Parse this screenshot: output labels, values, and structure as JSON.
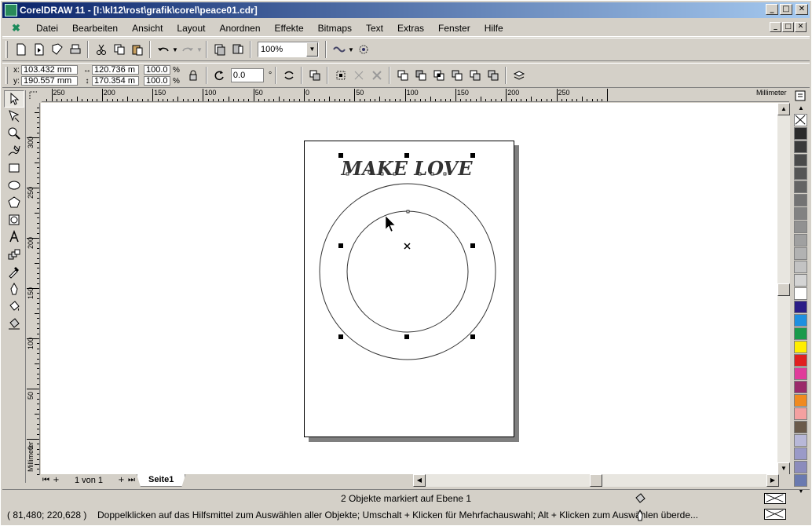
{
  "window": {
    "title": "CorelDRAW 11 - [I:\\kl12\\rost\\grafik\\corel\\peace01.cdr]",
    "buttons": [
      "_",
      "□",
      "✕"
    ]
  },
  "menubar": {
    "items": [
      "Datei",
      "Bearbeiten",
      "Ansicht",
      "Layout",
      "Anordnen",
      "Effekte",
      "Bitmaps",
      "Text",
      "Extras",
      "Fenster",
      "Hilfe"
    ]
  },
  "toolbar": {
    "zoom_value": "100%"
  },
  "propbar": {
    "x_label": "x:",
    "x_value": "103.432 mm",
    "y_label": "y:",
    "y_value": "190.557 mm",
    "w_value": "120.736 m",
    "h_value": "170.354 m",
    "scale_w": "100.0",
    "scale_h": "100.0",
    "pct_symbol": "%",
    "angle_value": "0.0",
    "degree_symbol": "°"
  },
  "ruler": {
    "h_labels": [
      "250",
      "200",
      "150",
      "100",
      "50",
      "0",
      "50",
      "100",
      "150",
      "200",
      "250"
    ],
    "h_unit": "Millimeter",
    "v_labels": [
      "300",
      "250",
      "200",
      "150",
      "100",
      "50",
      "0"
    ],
    "v_unit": "Millimeter"
  },
  "artwork": {
    "headline": "MAKE LOVE"
  },
  "pagenav": {
    "count": "1 von 1",
    "tab": "Seite1"
  },
  "palette": {
    "colors": [
      "#2b2b2b",
      "#3a3a3a",
      "#4a4a4a",
      "#555555",
      "#646464",
      "#737373",
      "#828282",
      "#919191",
      "#a0a0a0",
      "#b2b2b2",
      "#c3c3c3",
      "#d4d4d4",
      "#ffffff",
      "#2a1d86",
      "#1e90e0",
      "#1a9a4a",
      "#ffee00",
      "#e02020",
      "#e03a9a",
      "#9a2a6a",
      "#f08a20",
      "#f4a0a0",
      "#6a5a4a",
      "#b8b8d8",
      "#9a9ac8",
      "#8c8cbc",
      "#6a7ab0"
    ]
  },
  "status": {
    "line1": "2 Objekte markiert auf Ebene 1",
    "coords": "( 81,480; 220,628 )",
    "hint": "Doppelklicken auf das Hilfsmittel zum Auswählen aller Objekte; Umschalt + Klicken für Mehrfachauswahl; Alt + Klicken zum Auswählen überde..."
  }
}
